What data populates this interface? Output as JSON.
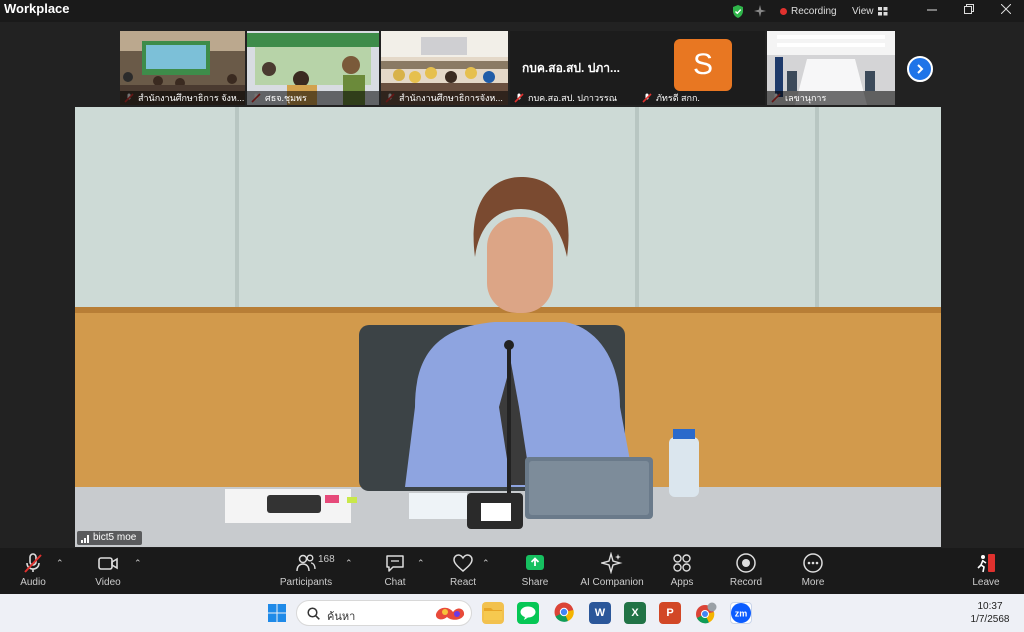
{
  "app": {
    "title": "Workplace"
  },
  "status": {
    "recording_label": "Recording",
    "view_label": "View"
  },
  "thumbnails": [
    {
      "name": "สำนักงานศึกษาธิการ จังห..."
    },
    {
      "name": "ศธจ.ชุมพร"
    },
    {
      "name": "สำนักงานศึกษาธิการจังห..."
    },
    {
      "name": "กบค.สอ.สป. ปภาวรรณ",
      "label": "กบค.สอ.สป. ปภา...",
      "avatar_letter": "S",
      "avatar_color": "#e87722"
    },
    {
      "name": "ภัทรดี สกก."
    },
    {
      "name": "เลขานุการ"
    }
  ],
  "main_video": {
    "speaker": "bict5 moe"
  },
  "toolbar": {
    "audio": "Audio",
    "video": "Video",
    "participants": "Participants",
    "participants_count": "168",
    "chat": "Chat",
    "react": "React",
    "share": "Share",
    "ai_companion": "AI Companion",
    "apps": "Apps",
    "record": "Record",
    "more": "More",
    "leave": "Leave"
  },
  "taskbar": {
    "search_placeholder": "ค้นหา",
    "time": "10:37",
    "date": "1/7/2568",
    "zoom_icon_label": "zm"
  },
  "colors": {
    "accent": "#1f74e8",
    "share_green": "#16c060",
    "leave_red": "#e0312e"
  }
}
